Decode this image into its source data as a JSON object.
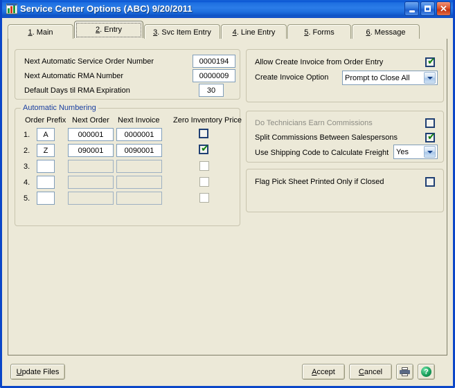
{
  "window": {
    "title": "Service Center Options (ABC) 9/20/2011",
    "app_icon": "chart-app-icon",
    "minimize_label": "Minimize",
    "maximize_label": "Maximize",
    "close_label": "Close",
    "accent_title_color": "#1d6ddd",
    "frame_color": "#0a46c8",
    "face_color": "#ece9d8"
  },
  "tabs": [
    {
      "num": "1",
      "label": "Main",
      "full": "1. Main",
      "selected": false
    },
    {
      "num": "2",
      "label": "Entry",
      "full": "2. Entry",
      "selected": true
    },
    {
      "num": "3",
      "label": "Svc Item Entry",
      "full": "3. Svc Item Entry",
      "selected": false
    },
    {
      "num": "4",
      "label": "Line Entry",
      "full": "4. Line Entry",
      "selected": false
    },
    {
      "num": "5",
      "label": "Forms",
      "full": "5. Forms",
      "selected": false
    },
    {
      "num": "6",
      "label": "Message",
      "full": "6. Message",
      "selected": false
    }
  ],
  "numbers_group": {
    "rows": [
      {
        "label": "Next Automatic Service Order Number",
        "value": "0000194"
      },
      {
        "label": "Next Automatic RMA Number",
        "value": "0000009"
      },
      {
        "label": "Default Days til RMA Expiration",
        "value": "30"
      }
    ]
  },
  "auto_numbering": {
    "legend": "Automatic Numbering",
    "columns": [
      "Order Prefix",
      "Next Order",
      "Next Invoice",
      "Zero Inventory Price"
    ],
    "rows": [
      {
        "index": "1.",
        "prefix": "A",
        "next_order": "000001",
        "next_invoice": "0000001",
        "zero_inventory_price": false,
        "enabled": true
      },
      {
        "index": "2.",
        "prefix": "Z",
        "next_order": "090001",
        "next_invoice": "0090001",
        "zero_inventory_price": true,
        "enabled": true
      },
      {
        "index": "3.",
        "prefix": "",
        "next_order": "",
        "next_invoice": "",
        "zero_inventory_price": false,
        "enabled": false
      },
      {
        "index": "4.",
        "prefix": "",
        "next_order": "",
        "next_invoice": "",
        "zero_inventory_price": false,
        "enabled": false
      },
      {
        "index": "5.",
        "prefix": "",
        "next_order": "",
        "next_invoice": "",
        "zero_inventory_price": false,
        "enabled": false
      }
    ]
  },
  "invoice_group": {
    "allow_create_invoice_label": "Allow Create Invoice from Order Entry",
    "allow_create_invoice_checked": true,
    "create_invoice_option_label": "Create Invoice Option",
    "create_invoice_option_value": "Prompt to Close All"
  },
  "commissions_group": {
    "do_technicians_label": "Do Technicians Earn Commissions",
    "do_technicians_checked": false,
    "do_technicians_disabled": true,
    "split_commissions_label": "Split Commissions Between Salespersons",
    "split_commissions_checked": true,
    "shipping_code_label": "Use Shipping Code to Calculate Freight",
    "shipping_code_value": "Yes"
  },
  "pick_sheet_group": {
    "flag_pick_sheet_label": "Flag Pick Sheet Printed Only if Closed",
    "flag_pick_sheet_checked": false
  },
  "buttons": {
    "update_files": "Update Files",
    "accept": "Accept",
    "cancel": "Cancel",
    "print_icon": "printer-icon",
    "help_icon": "help-icon",
    "help_glyph": "?"
  }
}
